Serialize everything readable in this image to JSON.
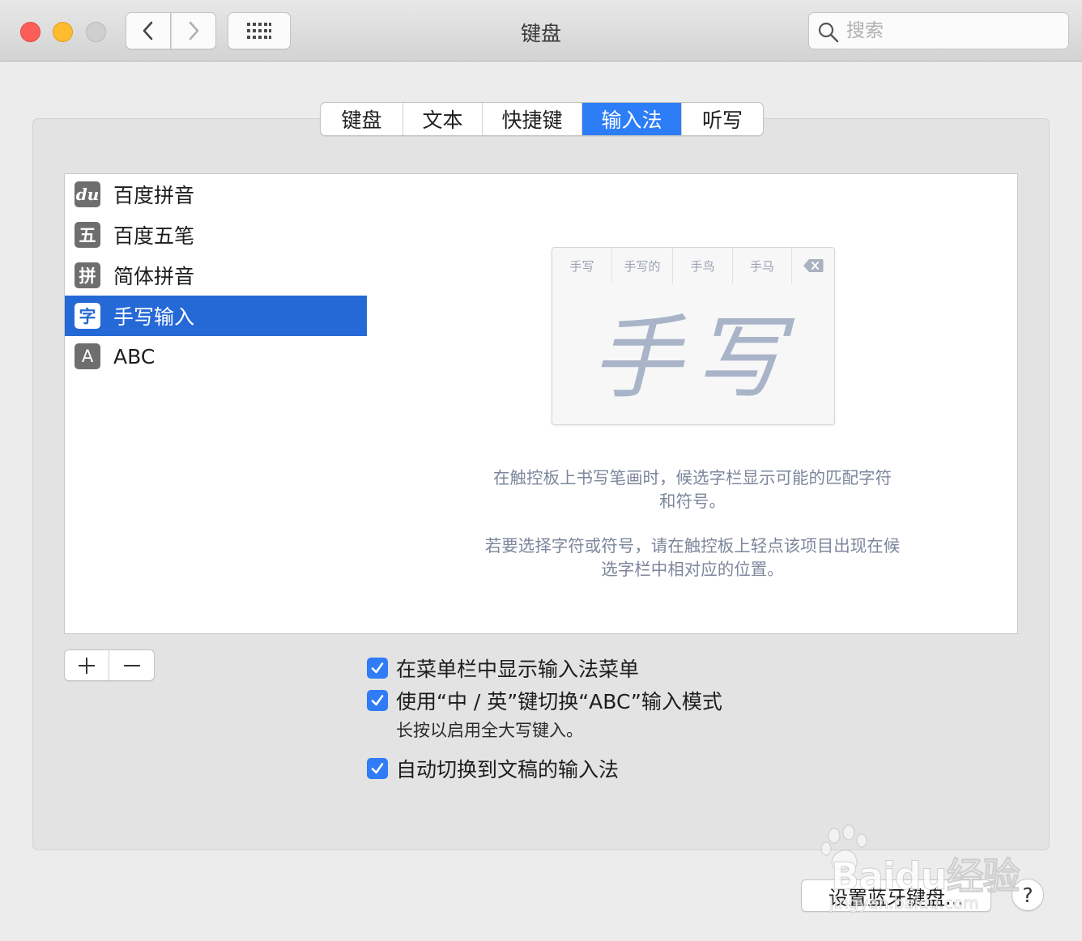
{
  "window": {
    "title": "键盘"
  },
  "search": {
    "placeholder": "搜索",
    "value": ""
  },
  "tabs": [
    {
      "label": "键盘",
      "active": false
    },
    {
      "label": "文本",
      "active": false
    },
    {
      "label": "快捷键",
      "active": false
    },
    {
      "label": "输入法",
      "active": true
    },
    {
      "label": "听写",
      "active": false
    }
  ],
  "input_sources": [
    {
      "icon": "du",
      "label": "百度拼音",
      "selected": false
    },
    {
      "icon": "五",
      "label": "百度五笔",
      "selected": false
    },
    {
      "icon": "拼",
      "label": "简体拼音",
      "selected": false
    },
    {
      "icon": "字",
      "label": "手写输入",
      "selected": true
    },
    {
      "icon": "A",
      "label": "ABC",
      "selected": false
    }
  ],
  "handwriting_preview": {
    "candidates": [
      "手写",
      "手写的",
      "手鸟",
      "手马"
    ],
    "delete_icon": "backspace-icon",
    "ink_text": "手写"
  },
  "description": {
    "line1": "在触控板上书写笔画时，候选字栏显示可能的匹配字符",
    "line2": "和符号。",
    "line3": "若要选择字符或符号，请在触控板上轻点该项目出现在候",
    "line4": "选字栏中相对应的位置。"
  },
  "list_controls": {
    "add": "+",
    "remove": "—"
  },
  "options": [
    {
      "label": "在菜单栏中显示输入法菜单",
      "checked": true
    },
    {
      "label": "使用“中 / 英”键切换“ABC”输入模式",
      "checked": true
    },
    {
      "label": "自动切换到文稿的输入法",
      "checked": true
    }
  ],
  "option_hint": "长按以启用全大写键入。",
  "buttons": {
    "bluetooth": "设置蓝牙键盘...",
    "help": "?"
  },
  "watermark": {
    "brand": "Baidu经验",
    "url": "jingyan.baidu.com"
  },
  "colors": {
    "accent": "#2c7df6",
    "selection": "#2569d6",
    "desc_text": "#7c879c"
  }
}
